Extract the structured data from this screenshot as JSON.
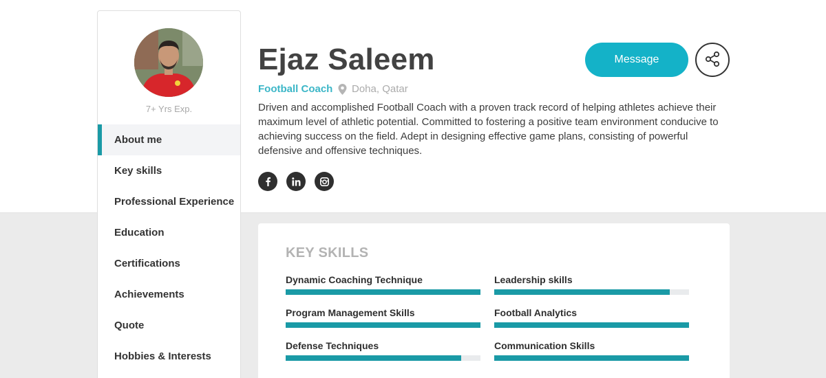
{
  "profile": {
    "name": "Ejaz Saleem",
    "role": "Football Coach",
    "location": "Doha, Qatar",
    "experience": "7+ Yrs Exp.",
    "bio": "Driven and accomplished Football Coach with a proven track record of helping athletes achieve their maximum level of athletic potential. Committed to fostering a positive team environment conducive to achieving success on the field. Adept in designing effective game plans, consisting of powerful defensive and offensive techniques."
  },
  "actions": {
    "message_label": "Message",
    "share_icon": "share-icon"
  },
  "social": [
    "facebook-icon",
    "linkedin-icon",
    "instagram-icon"
  ],
  "nav": {
    "items": [
      {
        "label": "About me",
        "active": true
      },
      {
        "label": "Key skills"
      },
      {
        "label": "Professional Experience"
      },
      {
        "label": "Education"
      },
      {
        "label": "Certifications"
      },
      {
        "label": "Achievements"
      },
      {
        "label": "Quote"
      },
      {
        "label": "Hobbies & Interests"
      }
    ]
  },
  "skills": {
    "title": "KEY SKILLS",
    "items": [
      {
        "label": "Dynamic Coaching Technique",
        "level": 1.0
      },
      {
        "label": "Leadership skills",
        "level": 0.9
      },
      {
        "label": "Program Management Skills",
        "level": 1.0
      },
      {
        "label": "Football Analytics",
        "level": 1.0
      },
      {
        "label": "Defense Techniques",
        "level": 0.9
      },
      {
        "label": "Communication Skills",
        "level": 1.0
      }
    ]
  },
  "colors": {
    "accent": "#1a9aa6",
    "button": "#14b2c8",
    "role_text": "#3bb6c7"
  }
}
